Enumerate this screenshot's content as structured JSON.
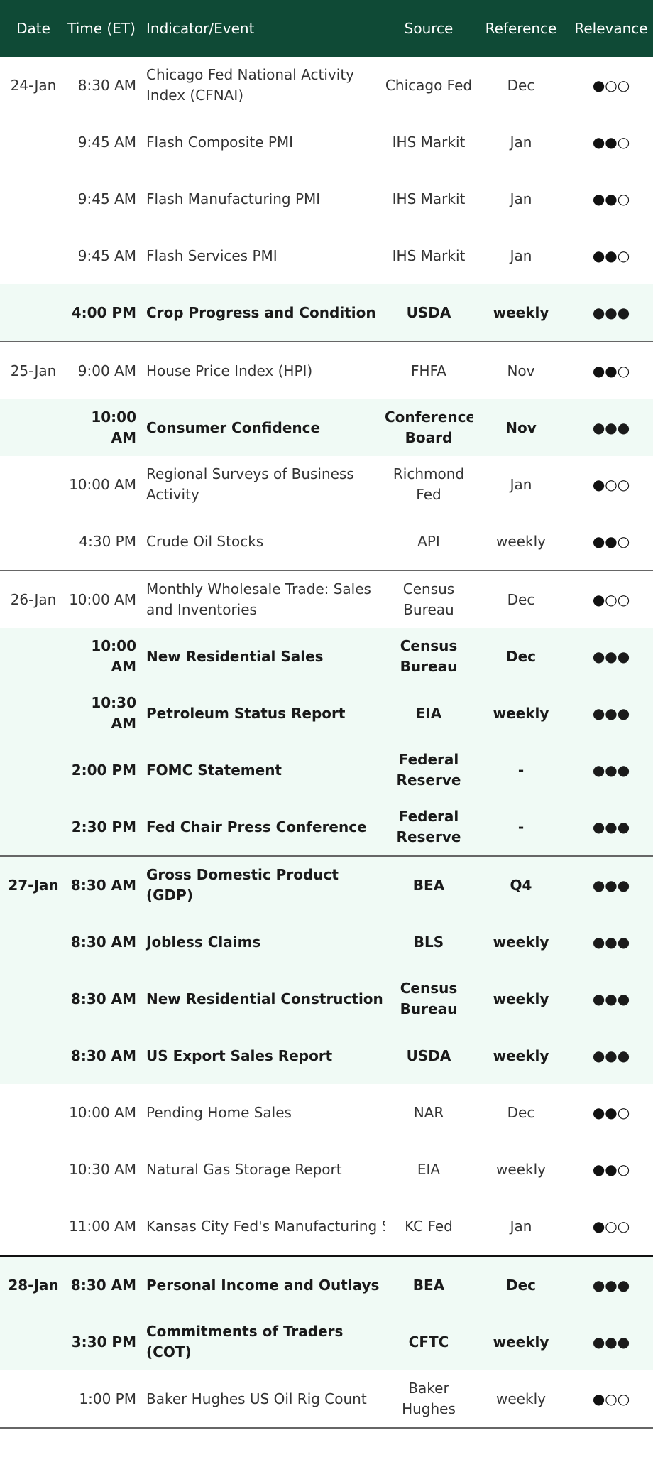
{
  "headers": {
    "date": "Date",
    "time": "Time (ET)",
    "event": "Indicator/Event",
    "source": "Source",
    "reference": "Reference",
    "relevance": "Relevance"
  },
  "colors": {
    "header_bg": "#0f4a36",
    "highlight_bg": "#f0faf5"
  },
  "rows": [
    {
      "date": "24-Jan",
      "time": "8:30 AM",
      "event": "Chicago Fed National Activity Index (CFNAI)",
      "source": "Chicago Fed",
      "reference": "Dec",
      "relevance": "●○○"
    },
    {
      "date": "",
      "time": "9:45 AM",
      "event": "Flash Composite PMI",
      "source": "IHS Markit",
      "reference": "Jan",
      "relevance": "●●○"
    },
    {
      "date": "",
      "time": "9:45 AM",
      "event": "Flash Manufacturing PMI",
      "source": "IHS Markit",
      "reference": "Jan",
      "relevance": "●●○"
    },
    {
      "date": "",
      "time": "9:45 AM",
      "event": "Flash Services PMI",
      "source": "IHS Markit",
      "reference": "Jan",
      "relevance": "●●○"
    },
    {
      "date": "",
      "time": "4:00 PM",
      "event": "Crop Progress and Condition",
      "source": "USDA",
      "reference": "weekly",
      "relevance": "●●●"
    },
    {
      "date": "25-Jan",
      "time": "9:00 AM",
      "event": "House Price Index (HPI)",
      "source": "FHFA",
      "reference": "Nov",
      "relevance": "●●○"
    },
    {
      "date": "",
      "time": "10:00 AM",
      "event": "Consumer Confidence",
      "source": "Conference Board",
      "reference": "Nov",
      "relevance": "●●●"
    },
    {
      "date": "",
      "time": "10:00 AM",
      "event": "Regional Surveys of Business Activity",
      "source": "Richmond Fed",
      "reference": "Jan",
      "relevance": "●○○"
    },
    {
      "date": "",
      "time": "4:30 PM",
      "event": "Crude Oil Stocks",
      "source": "API",
      "reference": "weekly",
      "relevance": "●●○"
    },
    {
      "date": "26-Jan",
      "time": "10:00 AM",
      "event": "Monthly Wholesale Trade: Sales and Inventories",
      "source": "Census Bureau",
      "reference": "Dec",
      "relevance": "●○○"
    },
    {
      "date": "",
      "time": "10:00 AM",
      "event": "New Residential Sales",
      "source": "Census Bureau",
      "reference": "Dec",
      "relevance": "●●●"
    },
    {
      "date": "",
      "time": "10:30 AM",
      "event": "Petroleum Status Report",
      "source": "EIA",
      "reference": "weekly",
      "relevance": "●●●"
    },
    {
      "date": "",
      "time": "2:00 PM",
      "event": "FOMC Statement",
      "source": "Federal Reserve",
      "reference": "-",
      "relevance": "●●●"
    },
    {
      "date": "",
      "time": "2:30 PM",
      "event": "Fed Chair Press Conference",
      "source": "Federal Reserve",
      "reference": "-",
      "relevance": "●●●"
    },
    {
      "date": "27-Jan",
      "time": "8:30 AM",
      "event": "Gross Domestic Product (GDP)",
      "source": "BEA",
      "reference": "Q4",
      "relevance": "●●●"
    },
    {
      "date": "",
      "time": "8:30 AM",
      "event": "Jobless Claims",
      "source": "BLS",
      "reference": "weekly",
      "relevance": "●●●"
    },
    {
      "date": "",
      "time": "8:30 AM",
      "event": "New Residential Construction",
      "source": "Census Bureau",
      "reference": "weekly",
      "relevance": "●●●"
    },
    {
      "date": "",
      "time": "8:30 AM",
      "event": "US Export Sales Report",
      "source": "USDA",
      "reference": "weekly",
      "relevance": "●●●"
    },
    {
      "date": "",
      "time": "10:00 AM",
      "event": "Pending Home Sales",
      "source": "NAR",
      "reference": "Dec",
      "relevance": "●●○"
    },
    {
      "date": "",
      "time": "10:30 AM",
      "event": "Natural Gas Storage Report",
      "source": "EIA",
      "reference": "weekly",
      "relevance": "●●○"
    },
    {
      "date": "",
      "time": "11:00 AM",
      "event": "Kansas City Fed's Manufacturing Su",
      "source": "KC Fed",
      "reference": "Jan",
      "relevance": "●○○"
    },
    {
      "date": "28-Jan",
      "time": "8:30 AM",
      "event": "Personal Income and Outlays",
      "source": "BEA",
      "reference": "Dec",
      "relevance": "●●●"
    },
    {
      "date": "",
      "time": "3:30 PM",
      "event": "Commitments of Traders (COT)",
      "source": "CFTC",
      "reference": "weekly",
      "relevance": "●●●"
    },
    {
      "date": "",
      "time": "1:00 PM",
      "event": "Baker Hughes US Oil Rig Count",
      "source": "Baker Hughes",
      "reference": "weekly",
      "relevance": "●○○"
    }
  ]
}
